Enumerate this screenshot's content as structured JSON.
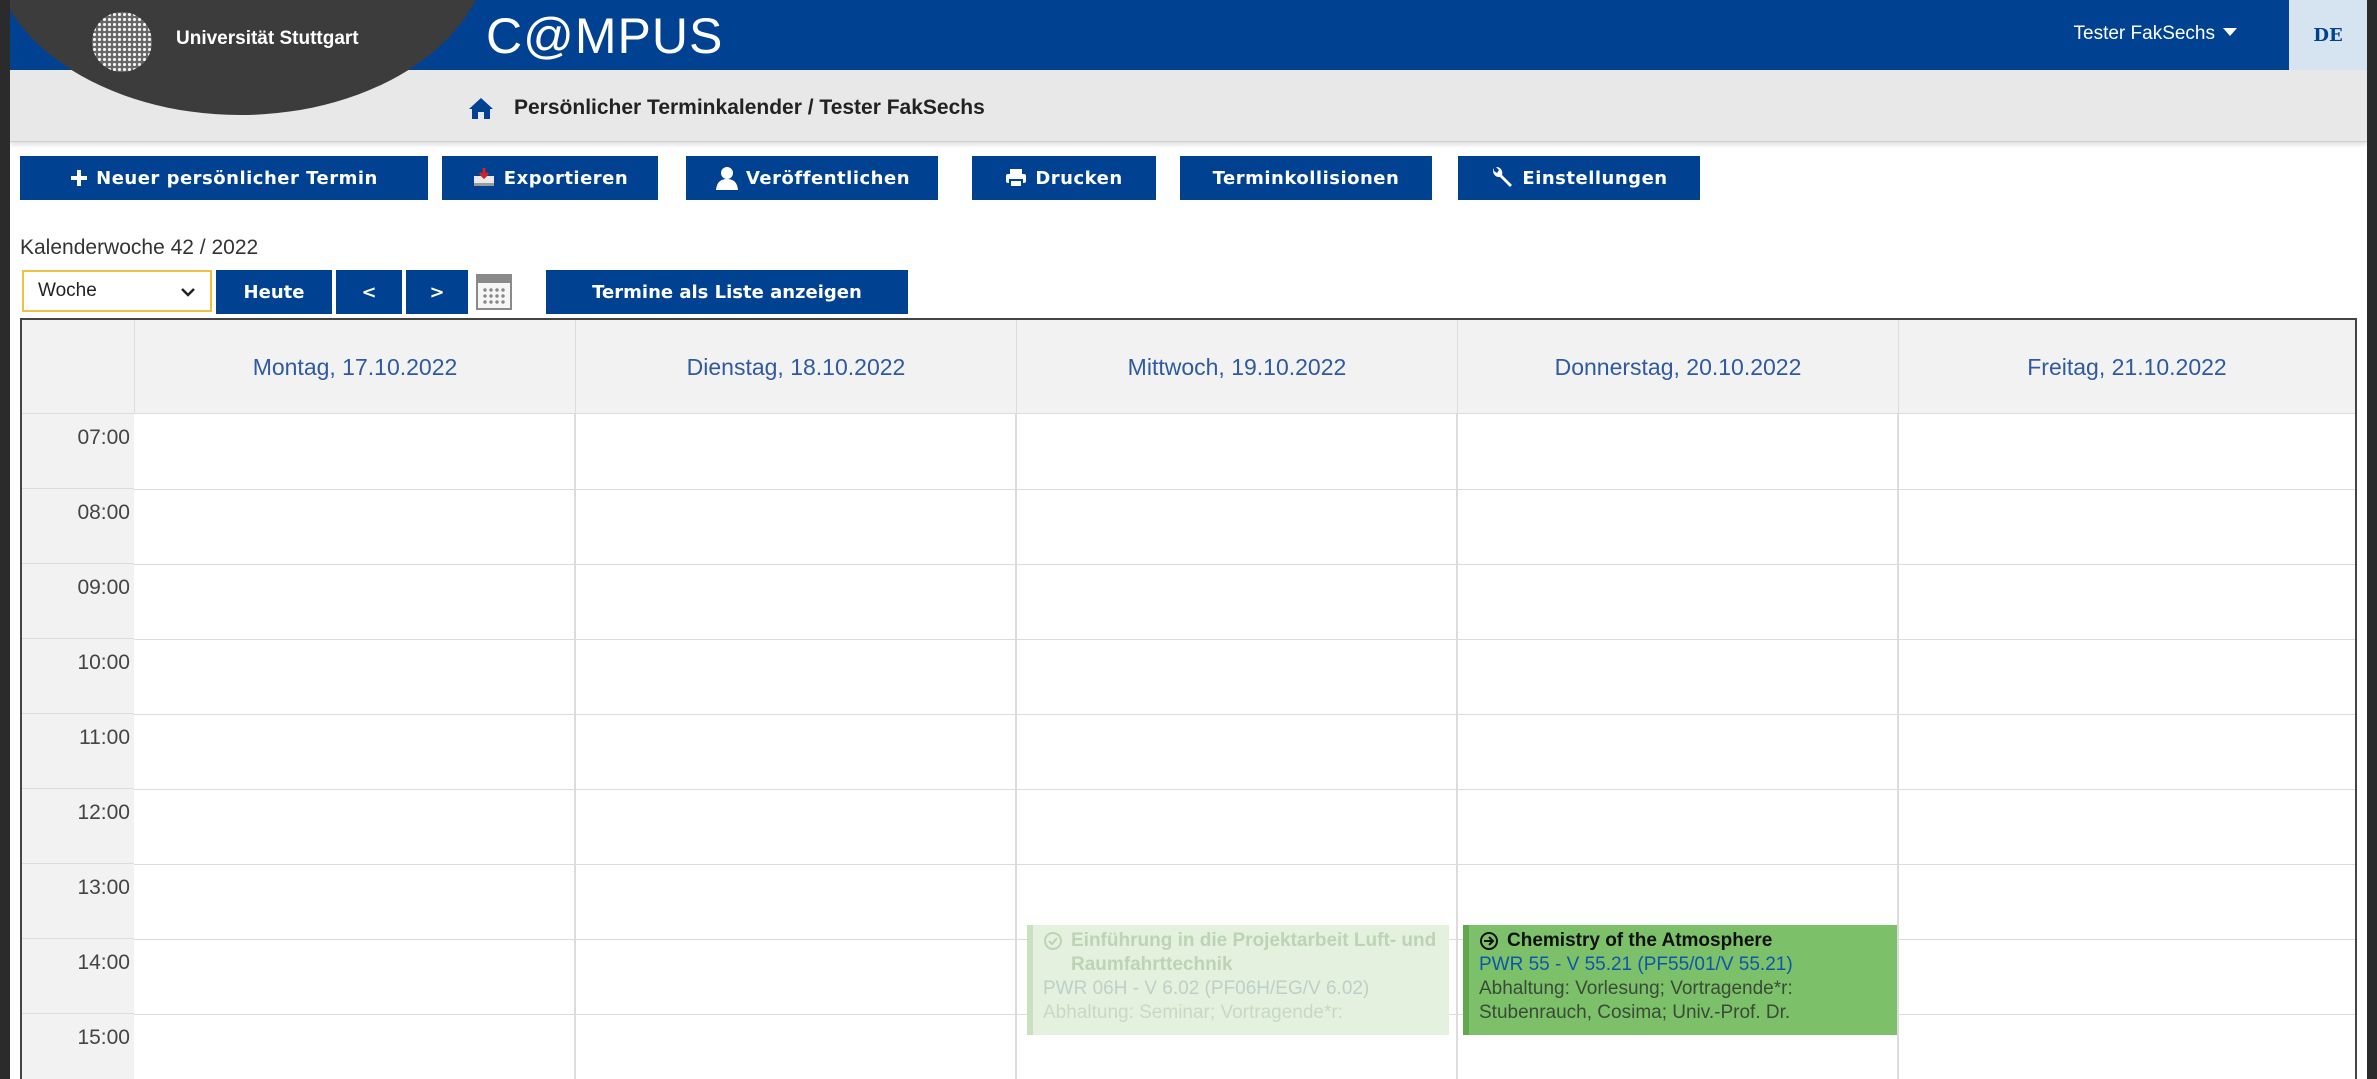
{
  "header": {
    "university": "Universität Stuttgart",
    "app_name": "C@MPUS",
    "user_menu": "Tester FakSechs",
    "language": "DE",
    "brand_color": "#004191"
  },
  "breadcrumb": {
    "title": "Persönlicher Terminkalender",
    "separator": "/",
    "user": "Tester FakSechs"
  },
  "toolbar": [
    {
      "label": "Neuer persönlicher Termin",
      "icon": "plus-icon"
    },
    {
      "label": "Exportieren",
      "icon": "export-icon"
    },
    {
      "label": "Veröffentlichen",
      "icon": "person-icon"
    },
    {
      "label": "Drucken",
      "icon": "print-icon"
    },
    {
      "label": "Terminkollisionen",
      "icon": ""
    },
    {
      "label": "Einstellungen",
      "icon": "wrench-icon"
    }
  ],
  "calendar_week": "Kalenderwoche 42 / 2022",
  "view": {
    "selected": "Woche",
    "today": "Heute",
    "prev": "<",
    "next": ">",
    "list_button": "Termine als Liste anzeigen"
  },
  "days": [
    "Montag, 17.10.2022",
    "Dienstag, 18.10.2022",
    "Mittwoch, 19.10.2022",
    "Donnerstag, 20.10.2022",
    "Freitag, 21.10.2022"
  ],
  "hours": [
    "07:00",
    "08:00",
    "09:00",
    "10:00",
    "11:00",
    "12:00",
    "13:00",
    "14:00",
    "15:00"
  ],
  "events": [
    {
      "day": "Mittwoch, 19.10.2022",
      "title": "Einführung in die Projektarbeit Luft- und Raumfahrttechnik",
      "room": "PWR 06H - V 6.02 (PF06H/EG/V 6.02)",
      "details": "Abhaltung: Seminar; Vortragende*r:",
      "state": "faded",
      "icon": "check-circle-icon",
      "color": "#e4f1df"
    },
    {
      "day": "Donnerstag, 20.10.2022",
      "title": "Chemistry of the Atmosphere",
      "room": "PWR 55 - V 55.21 (PF55/01/V 55.21)",
      "details": "Abhaltung: Vorlesung; Vortragende*r:",
      "details2": "Stubenrauch, Cosima; Univ.-Prof. Dr.",
      "state": "active",
      "icon": "arrow-circle-icon",
      "color": "#7cc16a"
    }
  ]
}
